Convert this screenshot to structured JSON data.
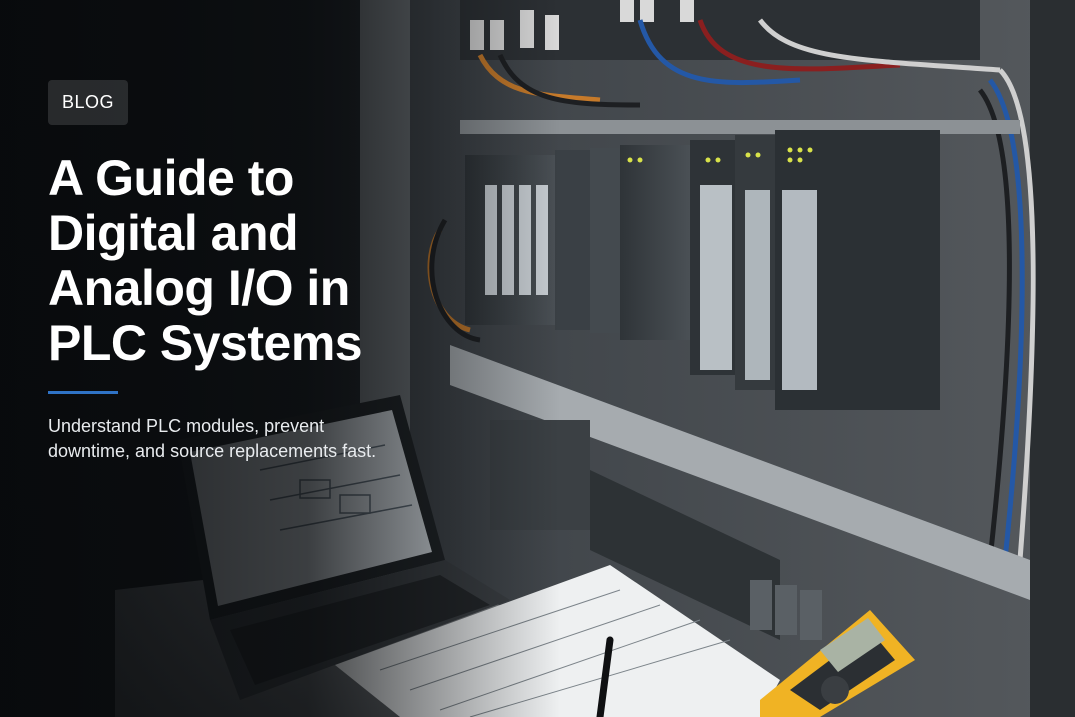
{
  "badge": "BLOG",
  "title_lines": [
    "A Guide to",
    "Digital and",
    "Analog I/O in",
    "PLC Systems"
  ],
  "subtitle_lines": [
    "Understand PLC modules, prevent",
    "downtime, and source replacements fast."
  ],
  "colors": {
    "accent": "#2f73c6",
    "text": "#ffffff"
  }
}
